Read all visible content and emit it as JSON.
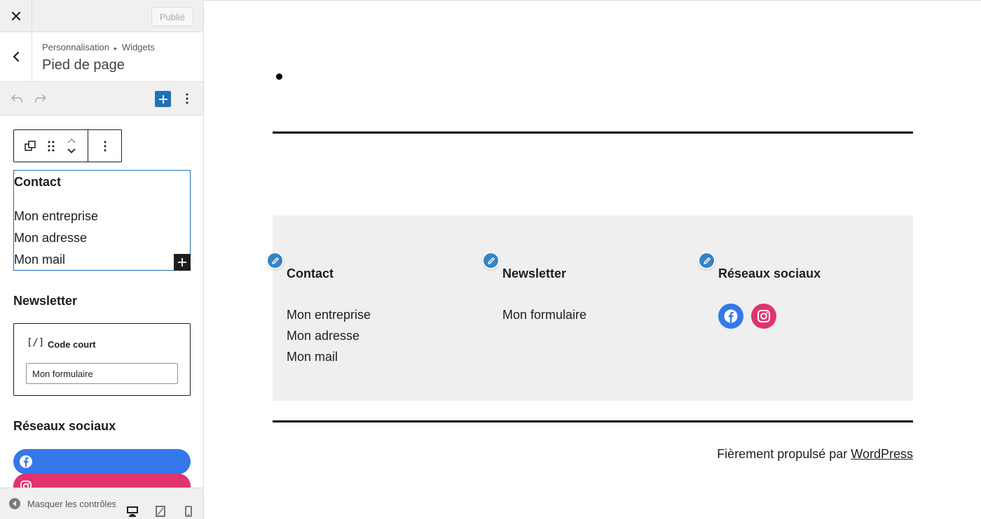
{
  "topbar": {
    "publish_label": "Publié"
  },
  "header": {
    "breadcrumb_parent": "Personnalisation",
    "breadcrumb_sep": "▸",
    "breadcrumb_child": "Widgets",
    "title": "Pied de page"
  },
  "sidebar": {
    "contact_block": {
      "heading": "Contact",
      "lines": [
        "Mon entreprise",
        "Mon adresse",
        "Mon mail"
      ]
    },
    "newsletter_heading": "Newsletter",
    "shortcode": {
      "label": "Code court",
      "icon_text": "[/]",
      "value": "Mon formulaire"
    },
    "social_heading": "Réseaux sociaux",
    "footer": {
      "collapse_label": "Masquer les contrôles"
    }
  },
  "preview": {
    "columns": [
      {
        "title": "Contact",
        "lines": [
          "Mon entreprise",
          "Mon adresse",
          "Mon mail"
        ]
      },
      {
        "title": "Newsletter",
        "lines": [
          "Mon formulaire"
        ]
      },
      {
        "title": "Réseaux sociaux"
      }
    ],
    "credit_prefix": "Fièrement propulsé par",
    "credit_link": "WordPress"
  },
  "colors": {
    "accent": "#2271b1",
    "facebook": "#3478ea",
    "instagram": "#e0336f",
    "footer_bg": "#efefef"
  },
  "icons": [
    "close-icon",
    "chevron-left-icon",
    "undo-icon",
    "redo-icon",
    "plus-icon",
    "more-vertical-icon",
    "copy-icon",
    "drag-handle-icon",
    "chevron-up-icon",
    "chevron-down-icon",
    "shortcode-icon",
    "facebook-icon",
    "instagram-icon",
    "collapse-arrow-icon",
    "desktop-icon",
    "tablet-icon",
    "mobile-icon",
    "pencil-icon"
  ]
}
